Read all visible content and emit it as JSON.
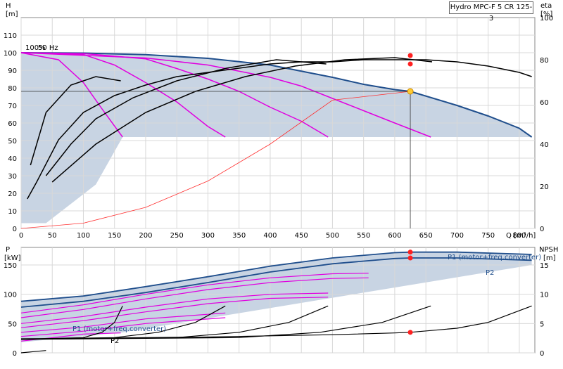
{
  "chart_data": [
    {
      "type": "line",
      "title": "Hydro MPC-F 5 CR 125-3",
      "xlabel": "Q [m³/h]",
      "ylabel_left": [
        "H",
        "[m]"
      ],
      "ylabel_right": [
        "eta",
        "[%]"
      ],
      "xlim": [
        0,
        825
      ],
      "ylim_left": [
        0,
        120
      ],
      "ylim_right": [
        0,
        100
      ],
      "x_ticks": [
        0,
        50,
        100,
        150,
        200,
        250,
        300,
        350,
        400,
        450,
        500,
        550,
        600,
        650,
        700,
        750,
        800
      ],
      "y_ticks_left": [
        0,
        10,
        20,
        30,
        40,
        50,
        60,
        70,
        80,
        90,
        100,
        110
      ],
      "y_ticks_right": [
        0,
        20,
        40,
        60,
        80,
        100
      ],
      "grid": true,
      "annotations": [
        "100%",
        "50 Hz"
      ],
      "operating_point": {
        "q": 625,
        "h": 78
      },
      "series": [
        {
          "color": "#1f4e8c",
          "axis": "left",
          "x": [
            0,
            100,
            200,
            300,
            400,
            500,
            550,
            600,
            625,
            700,
            750,
            800,
            820
          ],
          "y": [
            100,
            99.8,
            98.9,
            96.8,
            93,
            86,
            82,
            79,
            78,
            70,
            64,
            57,
            52
          ]
        },
        {
          "color": "#e000e0",
          "axis": "left",
          "x": [
            0,
            60,
            100,
            130,
            163
          ],
          "y": [
            100,
            96,
            83,
            68,
            52
          ]
        },
        {
          "color": "#e000e0",
          "axis": "left",
          "x": [
            0,
            100,
            150,
            200,
            250,
            300,
            328
          ],
          "y": [
            100,
            99,
            93,
            83,
            72,
            58,
            52
          ]
        },
        {
          "color": "#e000e0",
          "axis": "left",
          "x": [
            0,
            100,
            200,
            250,
            300,
            350,
            400,
            450,
            493
          ],
          "y": [
            100,
            99.5,
            96.5,
            91,
            85,
            78,
            69,
            61,
            52
          ]
        },
        {
          "color": "#e000e0",
          "axis": "left",
          "x": [
            0,
            200,
            300,
            400,
            450,
            500,
            550,
            600,
            658
          ],
          "y": [
            100,
            97,
            93,
            86,
            81,
            74,
            67,
            60,
            52
          ]
        },
        {
          "color": "#ff3030",
          "axis": "left",
          "x": [
            0,
            100,
            200,
            300,
            400,
            500,
            625
          ],
          "y": [
            0,
            3,
            12,
            27,
            48,
            73,
            78
          ]
        },
        {
          "color": "#000000",
          "axis": "right",
          "x": [
            10,
            25,
            60,
            100,
            150,
            200,
            250,
            300,
            350,
            400,
            450,
            500,
            550,
            600,
            650,
            700,
            750,
            800,
            820
          ],
          "y": [
            14,
            22,
            42,
            55,
            63,
            68,
            72,
            74,
            76,
            78,
            79,
            79,
            80,
            80,
            80,
            79,
            77,
            74,
            72
          ]
        },
        {
          "color": "#000000",
          "axis": "right",
          "x": [
            15,
            40,
            80,
            120,
            160
          ],
          "y": [
            30,
            55,
            68,
            72,
            70
          ]
        },
        {
          "color": "#000000",
          "axis": "right",
          "x": [
            40,
            80,
            120,
            180,
            250,
            330,
            410,
            490
          ],
          "y": [
            25,
            40,
            52,
            62,
            70,
            76,
            80,
            78
          ]
        },
        {
          "color": "#000000",
          "axis": "right",
          "x": [
            50,
            120,
            200,
            280,
            360,
            440,
            520,
            600,
            660
          ],
          "y": [
            22,
            40,
            55,
            65,
            72,
            77,
            80,
            81,
            79
          ]
        }
      ]
    },
    {
      "type": "line",
      "xlabel": "",
      "ylabel_left": [
        "P",
        "[kW]"
      ],
      "ylabel_right": [
        "NPSH",
        "[m]"
      ],
      "xlim": [
        0,
        825
      ],
      "ylim_left": [
        0,
        180
      ],
      "ylim_right": [
        0,
        18
      ],
      "y_ticks_left": [
        0,
        50,
        100,
        150
      ],
      "y_ticks_right": [
        0,
        5,
        10,
        15
      ],
      "grid": true,
      "legend_labels": [
        {
          "text": "P1 (motor+freq.converter)",
          "color": "#1f4e8c"
        },
        {
          "text": "P2",
          "color": "#1f4e8c"
        },
        {
          "text": "P1 (motor+freq.converter)",
          "color": "#e000e0"
        },
        {
          "text": "P2",
          "color": "#000000"
        }
      ],
      "operating_points": [
        {
          "q": 625,
          "p": 172
        },
        {
          "q": 625,
          "p": 162
        },
        {
          "q": 625,
          "npsh": 3.5
        }
      ],
      "series": [
        {
          "color": "#1f4e8c",
          "axis": "left",
          "x": [
            0,
            100,
            200,
            300,
            400,
            500,
            600,
            625,
            700,
            820
          ],
          "y": [
            88,
            97,
            113,
            130,
            148,
            162,
            171,
            172,
            172,
            168
          ]
        },
        {
          "color": "#1f4e8c",
          "axis": "left",
          "x": [
            0,
            100,
            200,
            300,
            400,
            500,
            600,
            625,
            700,
            820
          ],
          "y": [
            78,
            88,
            103,
            120,
            138,
            152,
            161,
            162,
            162,
            158
          ]
        },
        {
          "color": "#e000e0",
          "axis": "left",
          "x": [
            0,
            100,
            200,
            300,
            400,
            500,
            558
          ],
          "y": [
            68,
            82,
            100,
            116,
            128,
            135,
            136
          ]
        },
        {
          "color": "#e000e0",
          "axis": "left",
          "x": [
            0,
            100,
            200,
            300,
            400,
            500,
            558
          ],
          "y": [
            60,
            74,
            92,
            108,
            120,
            127,
            128
          ]
        },
        {
          "color": "#e000e0",
          "axis": "left",
          "x": [
            0,
            100,
            200,
            300,
            400,
            493
          ],
          "y": [
            50,
            62,
            78,
            92,
            100,
            102
          ]
        },
        {
          "color": "#e000e0",
          "axis": "left",
          "x": [
            0,
            100,
            200,
            300,
            400,
            493
          ],
          "y": [
            43,
            55,
            70,
            84,
            93,
            95
          ]
        },
        {
          "color": "#e000e0",
          "axis": "left",
          "x": [
            0,
            100,
            200,
            328
          ],
          "y": [
            35,
            44,
            58,
            68
          ]
        },
        {
          "color": "#e000e0",
          "axis": "left",
          "x": [
            0,
            100,
            200,
            328
          ],
          "y": [
            28,
            37,
            50,
            60
          ]
        },
        {
          "color": "#e000e0",
          "axis": "left",
          "x": [
            0,
            60,
            100,
            160
          ],
          "y": [
            20,
            27,
            32,
            34
          ]
        },
        {
          "color": "#000000",
          "axis": "right",
          "x": [
            0,
            100,
            200,
            300,
            400,
            500,
            600,
            625,
            700,
            750,
            820
          ],
          "y": [
            2.4,
            2.5,
            2.6,
            2.7,
            2.9,
            3.1,
            3.4,
            3.5,
            4.2,
            5.2,
            8
          ]
        },
        {
          "color": "#000000",
          "axis": "right",
          "x": [
            0,
            100,
            130,
            150,
            163
          ],
          "y": [
            2.3,
            2.6,
            3.5,
            5.2,
            8
          ]
        },
        {
          "color": "#000000",
          "axis": "right",
          "x": [
            0,
            150,
            220,
            280,
            328
          ],
          "y": [
            2.3,
            2.6,
            3.5,
            5.2,
            8
          ]
        },
        {
          "color": "#000000",
          "axis": "right",
          "x": [
            0,
            250,
            350,
            430,
            493
          ],
          "y": [
            2.3,
            2.6,
            3.5,
            5.2,
            8
          ]
        },
        {
          "color": "#000000",
          "axis": "right",
          "x": [
            0,
            350,
            480,
            580,
            658
          ],
          "y": [
            2.3,
            2.6,
            3.5,
            5.2,
            8
          ]
        },
        {
          "color": "#000000",
          "axis": "right",
          "x": [
            0,
            20,
            40
          ],
          "y": [
            0,
            0.2,
            0.4
          ]
        }
      ]
    }
  ]
}
